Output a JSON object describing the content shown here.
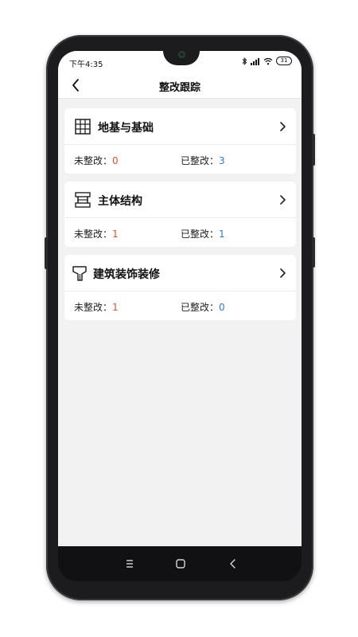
{
  "statusbar": {
    "time": "下午4:35",
    "battery": "31"
  },
  "navbar": {
    "title": "整改跟踪"
  },
  "cards": [
    {
      "title": "地基与基础",
      "icon": "grid-icon",
      "pending_label": "未整改：",
      "pending_value": "0",
      "done_label": "已整改：",
      "done_value": "3"
    },
    {
      "title": "主体结构",
      "icon": "structure-icon",
      "pending_label": "未整改：",
      "pending_value": "1",
      "done_label": "已整改：",
      "done_value": "1"
    },
    {
      "title": "建筑装饰装修",
      "icon": "brush-icon",
      "pending_label": "未整改：",
      "pending_value": "1",
      "done_label": "已整改：",
      "done_value": "0"
    }
  ],
  "colors": {
    "pending": "#e0532f",
    "done": "#2a7bd0"
  }
}
